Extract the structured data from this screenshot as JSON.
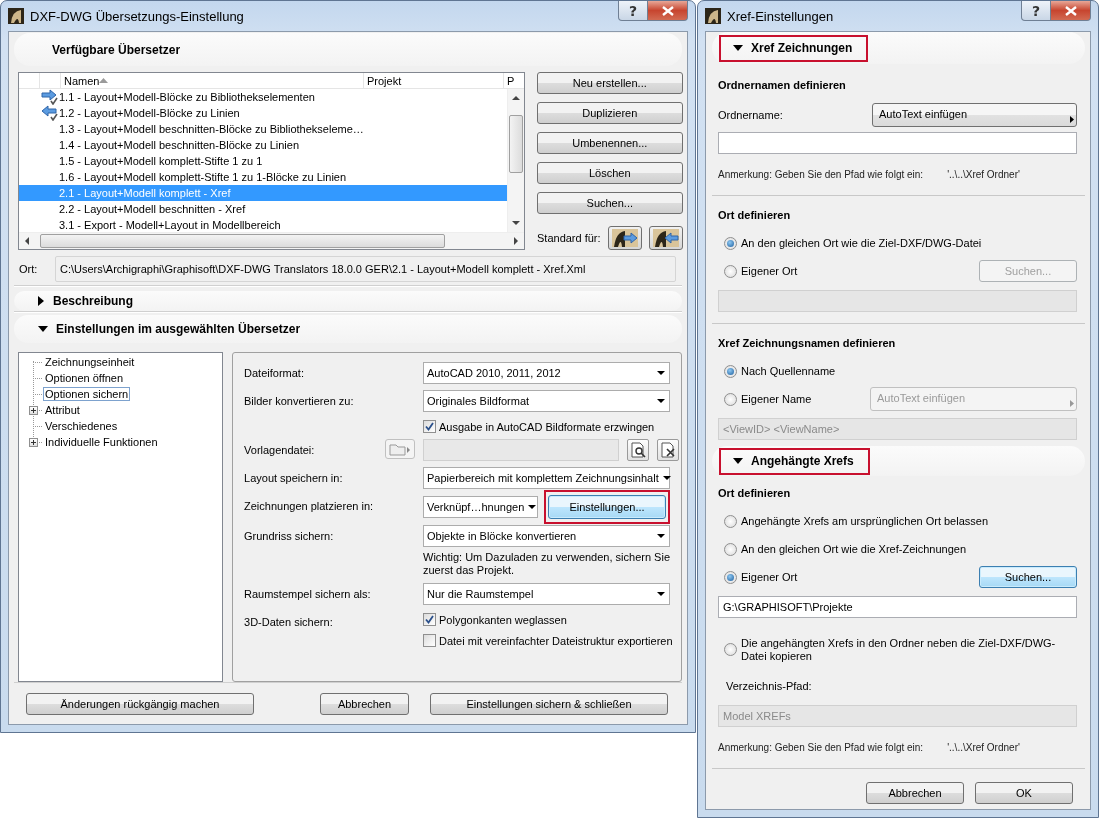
{
  "left_window": {
    "title": "DXF-DWG Übersetzungs-Einstellung",
    "help_button": "?",
    "translators": {
      "header": "Verfügbare Übersetzer",
      "columns": [
        {
          "label": "Namen",
          "sorted": true
        },
        {
          "label": "Projekt",
          "sorted": false
        },
        {
          "label": "P",
          "sorted": false
        }
      ],
      "rows": [
        {
          "name": "1.1 - Layout+Modell-Blöcke zu Bibliothekselementen",
          "export_default": true,
          "import_default": false,
          "selected": false
        },
        {
          "name": "1.2 - Layout+Modell-Blöcke zu Linien",
          "export_default": false,
          "import_default": true,
          "selected": false
        },
        {
          "name": "1.3 - Layout+Modell beschnitten-Blöcke zu Bibliothekseleme…",
          "selected": false
        },
        {
          "name": "1.4 - Layout+Modell beschnitten-Blöcke zu Linien",
          "selected": false
        },
        {
          "name": "1.5 - Layout+Modell komplett-Stifte 1 zu 1",
          "selected": false
        },
        {
          "name": "1.6 - Layout+Modell komplett-Stifte 1 zu 1-Blöcke zu Linien",
          "selected": false
        },
        {
          "name": "2.1 - Layout+Modell komplett - Xref",
          "selected": true
        },
        {
          "name": "2.2 - Layout+Modell beschnitten - Xref",
          "selected": false
        },
        {
          "name": "3.1 - Export - Modell+Layout in Modellbereich",
          "selected": false
        }
      ],
      "buttons": [
        "Neu erstellen...",
        "Duplizieren",
        "Umbenennen...",
        "Löschen",
        "Suchen..."
      ],
      "standard_label": "Standard für:"
    },
    "location": {
      "label": "Ort:",
      "value": "C:\\Users\\Archigraphi\\Graphisoft\\DXF-DWG Translators 18.0.0 GER\\2.1 - Layout+Modell komplett - Xref.Xml"
    },
    "description": {
      "header": "Beschreibung",
      "expanded": false
    },
    "settings": {
      "header": "Einstellungen im ausgewählten Übersetzer",
      "expanded": true,
      "tree": [
        {
          "label": "Zeichnungseinheit",
          "expandable": false,
          "selected": false
        },
        {
          "label": "Optionen öffnen",
          "expandable": false,
          "selected": false
        },
        {
          "label": "Optionen sichern",
          "expandable": false,
          "selected": true
        },
        {
          "label": "Attribut",
          "expandable": true,
          "selected": false
        },
        {
          "label": "Verschiedenes",
          "expandable": false,
          "selected": false
        },
        {
          "label": "Individuelle Funktionen",
          "expandable": true,
          "selected": false
        }
      ],
      "rows": [
        {
          "label": "Dateiformat:",
          "controls": [
            {
              "kind": "dropdown",
              "value": "AutoCAD 2010, 2011, 2012"
            }
          ]
        },
        {
          "label": "Bilder konvertieren zu:",
          "controls": [
            {
              "kind": "dropdown",
              "value": "Originales Bildformat"
            },
            {
              "kind": "checkbox",
              "label": "Ausgabe in AutoCAD Bildformate erzwingen",
              "checked": true
            }
          ]
        },
        {
          "label": "Vorlagendatei:",
          "controls": [
            {
              "kind": "file_picker",
              "disabled": true
            }
          ]
        },
        {
          "label": "Layout speichern in:",
          "controls": [
            {
              "kind": "dropdown",
              "value": "Papierbereich mit komplettem Zeichnungsinhalt"
            }
          ]
        },
        {
          "label": "Zeichnungen platzieren in:",
          "controls": [
            {
              "kind": "dropdown",
              "value": "Verknüpf…hnungen"
            },
            {
              "kind": "button",
              "label": "Einstellungen...",
              "focused": true,
              "annotated": true
            }
          ]
        },
        {
          "label": "Grundriss sichern:",
          "controls": [
            {
              "kind": "dropdown",
              "value": "Objekte in Blöcke konvertieren"
            },
            {
              "kind": "note",
              "text": "Wichtig: Um Dazuladen zu verwenden, sichern Sie zuerst das Projekt."
            }
          ]
        },
        {
          "label": "Raumstempel sichern als:",
          "controls": [
            {
              "kind": "dropdown",
              "value": "Nur die Raumstempel"
            }
          ]
        },
        {
          "label": "3D-Daten sichern:",
          "controls": [
            {
              "kind": "checkbox",
              "label": "Polygonkanten weglassen",
              "checked": true
            },
            {
              "kind": "checkbox",
              "label": "Datei mit vereinfachter Dateistruktur exportieren",
              "checked": false
            }
          ]
        }
      ]
    },
    "buttons": [
      "Änderungen rückgängig machen",
      "Abbrechen",
      "Einstellungen sichern & schließen"
    ]
  },
  "right_window": {
    "title": "Xref-Einstellungen",
    "help_button": "?",
    "sections": [
      {
        "header": "Xref Zeichnungen",
        "expanded": true,
        "annotated": true,
        "items": [
          {
            "kind": "heading",
            "text": "Ordnernamen definieren"
          },
          {
            "kind": "picker",
            "label": "Ordnername:",
            "autotext": {
              "label": "AutoText einfügen",
              "disabled": false
            }
          },
          {
            "kind": "field",
            "disabled": false
          },
          {
            "kind": "note",
            "text": "Anmerkung: Geben Sie den Pfad wie folgt ein:",
            "example": "'..\\..\\Xref Ordner'"
          },
          {
            "kind": "divider"
          },
          {
            "kind": "heading",
            "text": "Ort definieren"
          },
          {
            "kind": "radio",
            "label": "An den gleichen Ort wie die Ziel-DXF/DWG-Datei",
            "selected": true
          },
          {
            "kind": "radio",
            "label": "Eigener Ort",
            "selected": false,
            "button": {
              "label": "Suchen...",
              "disabled": true
            }
          },
          {
            "kind": "field",
            "disabled": true
          },
          {
            "kind": "divider"
          },
          {
            "kind": "heading",
            "text": "Xref Zeichnungsnamen definieren"
          },
          {
            "kind": "radio",
            "label": "Nach Quellenname",
            "selected": true
          },
          {
            "kind": "radio",
            "label": "Eigener Name",
            "selected": false,
            "autotext": {
              "label": "AutoText einfügen",
              "disabled": true
            }
          },
          {
            "kind": "field",
            "disabled": true,
            "value": "<ViewID> <ViewName>"
          }
        ]
      },
      {
        "header": "Angehängte Xrefs",
        "expanded": true,
        "annotated": true,
        "items": [
          {
            "kind": "heading",
            "text": "Ort definieren"
          },
          {
            "kind": "radio",
            "label": "Angehängte Xrefs am ursprünglichen Ort belassen",
            "selected": false
          },
          {
            "kind": "radio",
            "label": "An den gleichen Ort wie die Xref-Zeichnungen",
            "selected": false
          },
          {
            "kind": "radio",
            "label": "Eigener Ort",
            "selected": true,
            "button": {
              "label": "Suchen...",
              "disabled": false,
              "focused": true
            }
          },
          {
            "kind": "field",
            "disabled": false,
            "value": "G:\\GRAPHISOFT\\Projekte"
          },
          {
            "kind": "radio",
            "label": "Die angehängten Xrefs in den Ordner neben die Ziel-DXF/DWG-Datei kopieren",
            "selected": false
          },
          {
            "kind": "label",
            "text": "Verzeichnis-Pfad:"
          },
          {
            "kind": "field",
            "disabled": true,
            "value": "Model XREFs"
          },
          {
            "kind": "note",
            "text": "Anmerkung: Geben Sie den Pfad wie folgt ein:",
            "example": "'..\\..\\Xref Ordner'"
          },
          {
            "kind": "divider"
          }
        ]
      }
    ],
    "buttons": [
      "Abbrechen",
      "OK"
    ]
  }
}
